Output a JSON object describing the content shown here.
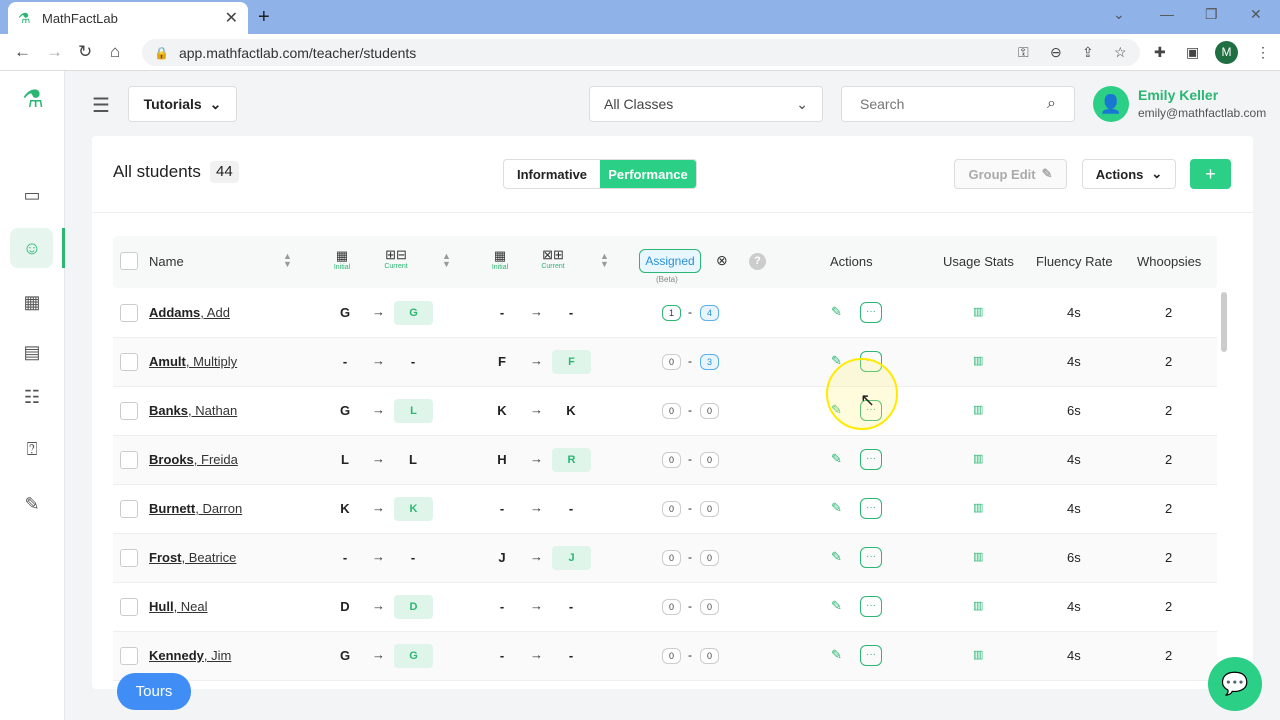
{
  "browser": {
    "tab_title": "MathFactLab",
    "url": "app.mathfactlab.com/teacher/students",
    "profile_initial": "M"
  },
  "header": {
    "tutorials_label": "Tutorials",
    "class_select_value": "All Classes",
    "search_placeholder": "Search",
    "user_name": "Emily Keller",
    "user_email": "emily@mathfactlab.com"
  },
  "toolbar": {
    "title": "All students",
    "count": "44",
    "view_informative": "Informative",
    "view_performance": "Performance",
    "group_edit_label": "Group Edit",
    "actions_label": "Actions",
    "add_label": "+"
  },
  "table": {
    "col_name": "Name",
    "col_initial": "Initial",
    "col_current": "Current",
    "col_assigned": "Assigned",
    "col_beta": "(Beta)",
    "col_actions": "Actions",
    "col_usage": "Usage Stats",
    "col_fluency": "Fluency Rate",
    "col_whoopsies": "Whoopsies",
    "rows": [
      {
        "last": "Addams",
        "first": ", Add",
        "ai": "G",
        "ac": "G",
        "ac_badge": true,
        "mi": "-",
        "mc": "-",
        "mc_badge": false,
        "a1": "1",
        "a2": "4",
        "a1g": true,
        "a2b": true,
        "fluency": "4s",
        "whoops": "2"
      },
      {
        "last": "Amult",
        "first": ", Multiply",
        "ai": "-",
        "ac": "-",
        "ac_badge": false,
        "mi": "F",
        "mc": "F",
        "mc_badge": true,
        "a1": "0",
        "a2": "3",
        "a1g": false,
        "a2b": true,
        "fluency": "4s",
        "whoops": "2"
      },
      {
        "last": "Banks",
        "first": ", Nathan",
        "ai": "G",
        "ac": "L",
        "ac_badge": true,
        "mi": "K",
        "mc": "K",
        "mc_badge": false,
        "a1": "0",
        "a2": "0",
        "a1g": false,
        "a2b": false,
        "fluency": "6s",
        "whoops": "2"
      },
      {
        "last": "Brooks",
        "first": ", Freida",
        "ai": "L",
        "ac": "L",
        "ac_badge": false,
        "mi": "H",
        "mc": "R",
        "mc_badge": true,
        "a1": "0",
        "a2": "0",
        "a1g": false,
        "a2b": false,
        "fluency": "4s",
        "whoops": "2"
      },
      {
        "last": "Burnett",
        "first": ", Darron",
        "ai": "K",
        "ac": "K",
        "ac_badge": true,
        "mi": "-",
        "mc": "-",
        "mc_badge": false,
        "a1": "0",
        "a2": "0",
        "a1g": false,
        "a2b": false,
        "fluency": "4s",
        "whoops": "2"
      },
      {
        "last": "Frost",
        "first": ", Beatrice",
        "ai": "-",
        "ac": "-",
        "ac_badge": false,
        "mi": "J",
        "mc": "J",
        "mc_badge": true,
        "a1": "0",
        "a2": "0",
        "a1g": false,
        "a2b": false,
        "fluency": "6s",
        "whoops": "2"
      },
      {
        "last": "Hull",
        "first": ", Neal",
        "ai": "D",
        "ac": "D",
        "ac_badge": true,
        "mi": "-",
        "mc": "-",
        "mc_badge": false,
        "a1": "0",
        "a2": "0",
        "a1g": false,
        "a2b": false,
        "fluency": "4s",
        "whoops": "2"
      },
      {
        "last": "Kennedy",
        "first": ", Jim",
        "ai": "G",
        "ac": "G",
        "ac_badge": true,
        "mi": "-",
        "mc": "-",
        "mc_badge": false,
        "a1": "0",
        "a2": "0",
        "a1g": false,
        "a2b": false,
        "fluency": "4s",
        "whoops": "2"
      }
    ]
  },
  "footer": {
    "tours_label": "Tours"
  },
  "colors": {
    "accent": "#2bcf86",
    "brand_green": "#2bb673",
    "tours_blue": "#3f8df5"
  }
}
